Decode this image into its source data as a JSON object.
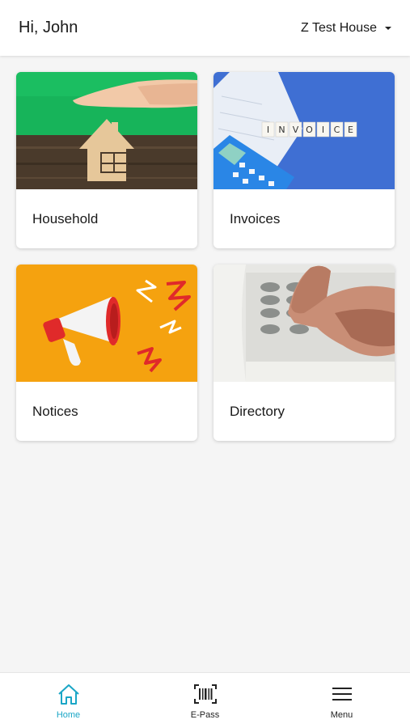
{
  "header": {
    "greeting": "Hi, John",
    "house_name": "Z Test House"
  },
  "cards": [
    {
      "label": "Household",
      "image": "hand-over-house-photo"
    },
    {
      "label": "Invoices",
      "image": "invoice-calculator-photo"
    },
    {
      "label": "Notices",
      "image": "megaphone-photo"
    },
    {
      "label": "Directory",
      "image": "phone-keypad-photo"
    }
  ],
  "bottom_nav": {
    "items": [
      {
        "label": "Home",
        "icon": "home-icon",
        "active": true
      },
      {
        "label": "E-Pass",
        "icon": "barcode-icon",
        "active": false
      },
      {
        "label": "Menu",
        "icon": "hamburger-menu-icon",
        "active": false
      }
    ]
  },
  "colors": {
    "accent": "#1aa6c6",
    "background": "#f5f5f5",
    "surface": "#ffffff"
  }
}
